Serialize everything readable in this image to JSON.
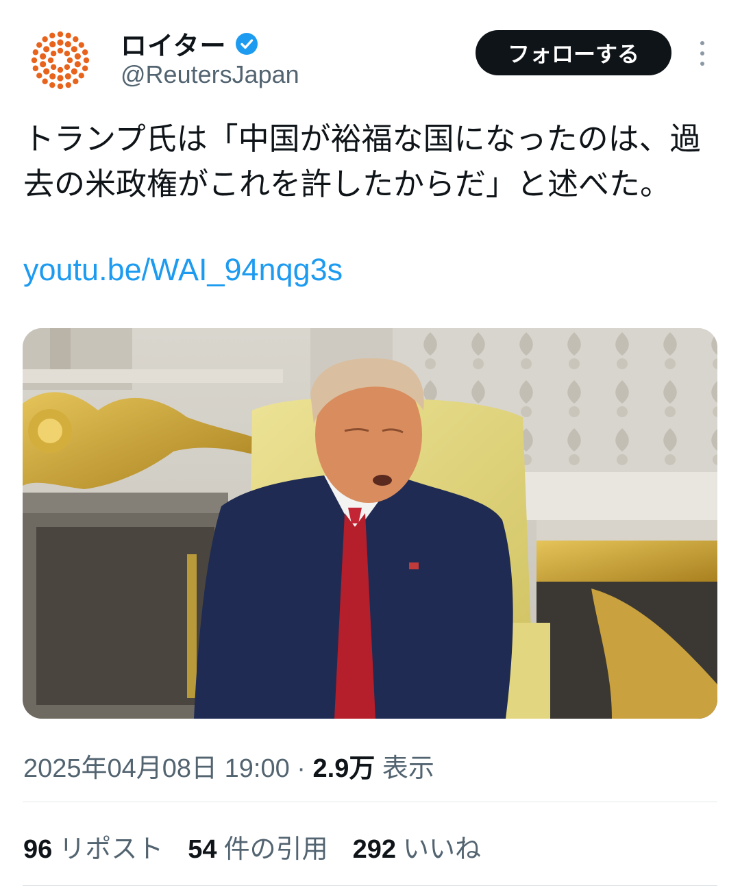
{
  "author": {
    "display_name": "ロイター",
    "handle": "@ReutersJapan",
    "verified": true,
    "avatar_icon": "reuters-logo-icon",
    "brand_color": "#e8631c"
  },
  "actions": {
    "follow_label": "フォローする",
    "more_icon": "more-vertical-icon"
  },
  "tweet": {
    "text": "トランプ氏は「中国が裕福な国になったのは、過去の米政権がこれを許したからだ」と述べた。",
    "link": "youtu.be/WAI_94nqg3s",
    "link_color": "#1d9bf0"
  },
  "meta": {
    "timestamp": "2025年04月08日 19:00",
    "separator": "·",
    "views_count": "2.9万",
    "views_label": "表示"
  },
  "stats": {
    "reposts_count": "96",
    "reposts_label": "リポスト",
    "quotes_count": "54",
    "quotes_label": "件の引用",
    "likes_count": "292",
    "likes_label": "いいね"
  }
}
